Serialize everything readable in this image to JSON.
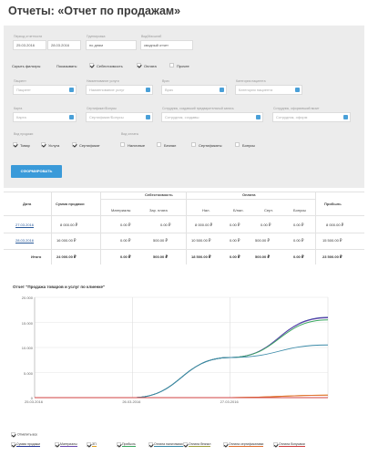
{
  "page": {
    "title": "Отчеты: «Отчет по продажам»"
  },
  "filters": {
    "period_label": "Период отчетности",
    "date_from": "25.03.2016",
    "date_to": "28.03.2016",
    "group_label": "Группировка",
    "group_value": "по дням",
    "mode_label": "Вид/Масштаб",
    "mode_value": "сводный отчет",
    "hide_filters": "Скрыть фильтры",
    "show_label": "Показывать:",
    "show_items": [
      "Себестоимость",
      "Оплата",
      "Прочее"
    ],
    "patient_label": "Пациент",
    "patient_ph": "Пациент",
    "service_label": "Наименование услуги",
    "service_ph": "Наименование услуг",
    "doctor_label": "Врач",
    "doctor_ph": "Врач",
    "service_cat_label": "Категория пациента",
    "service_cat_ph": "Категория пациента",
    "card_label": "Карта",
    "card_ph": "Карта",
    "coupon_label": "Сертификат/Бонусы",
    "coupon_ph": "Сертификат/Бонусы",
    "employee_label": "Сотрудник, создавший предварительный запись",
    "employee_ph": "Сотрудник, создавш",
    "employee2_label": "Сотрудник, оформивший визит",
    "employee2_ph": "Сотрудник, оформ",
    "sale_type_label": "Вид продажи",
    "sale_types": [
      "Товар",
      "Услуга",
      "Сертификат"
    ],
    "pay_type_label": "Вид оплаты",
    "pay_types": [
      "Наличные",
      "Безнал",
      "Сертификаты",
      "Бонусы"
    ],
    "submit": "СФОРМИРОВАТЬ"
  },
  "table": {
    "h_date": "Дата",
    "h_sum": "Сумма продажи",
    "h_cost": "Себестоимость",
    "h_pay": "Оплата",
    "h_profit": "Прибыль",
    "sub": [
      "Материалы",
      "Зар. плата",
      "Нал.",
      "Б/нал.",
      "Серт.",
      "Бонусы"
    ],
    "rows": [
      {
        "date": "27.03.2016",
        "sum": "8 000.00 ₽",
        "mat": "0.00 ₽",
        "zp": "0.00 ₽",
        "nal": "8 000.00 ₽",
        "bn": "0.00 ₽",
        "sert": "0.00 ₽",
        "bon": "0.00 ₽",
        "profit": "8 000.00 ₽"
      },
      {
        "date": "28.03.2016",
        "sum": "16 000.00 ₽",
        "mat": "0.00 ₽",
        "zp": "500.00 ₽",
        "nal": "10 500.00 ₽",
        "bn": "0.00 ₽",
        "sert": "500.00 ₽",
        "bon": "0.00 ₽",
        "profit": "15 500.00 ₽"
      }
    ],
    "total": {
      "label": "Итого",
      "sum": "24 000.00 ₽",
      "mat": "0.00 ₽",
      "zp": "500.00 ₽",
      "nal": "18 500.00 ₽",
      "bn": "0.00 ₽",
      "sert": "500.00 ₽",
      "bon": "0.00 ₽",
      "profit": "23 500.00 ₽"
    }
  },
  "chart_data": {
    "type": "line",
    "title": "Отчет \"Продажа товаров и услуг по клиенке\"",
    "x": [
      "25.03.2016",
      "26.03.2016",
      "27.03.2016",
      "28.03.2016"
    ],
    "x_ticks": [
      "25.03.2016",
      "26.03.2016",
      "27.03.2016"
    ],
    "y_ticks": [
      "0",
      "5.000",
      "10.000",
      "15.000",
      "20.000"
    ],
    "ylim": [
      0,
      20000
    ],
    "series": [
      {
        "name": "Сумма продажи",
        "color": "#2a3a9a",
        "values": [
          0,
          0,
          8000,
          16000
        ]
      },
      {
        "name": "Материалы",
        "color": "#6a4ab0",
        "values": [
          0,
          0,
          8000,
          15900
        ]
      },
      {
        "name": "ЗП",
        "color": "#e0a020",
        "values": [
          0,
          0,
          0,
          500
        ]
      },
      {
        "name": "Прибыль",
        "color": "#3aa860",
        "values": [
          0,
          0,
          8000,
          15500
        ]
      },
      {
        "name": "Оплата наличными",
        "color": "#3a8aa8",
        "values": [
          0,
          0,
          8000,
          10500
        ]
      },
      {
        "name": "Оплата безнал",
        "color": "#a0a040",
        "values": [
          0,
          0,
          0,
          0
        ]
      },
      {
        "name": "Оплата сертификатами",
        "color": "#e07030",
        "values": [
          0,
          0,
          0,
          500
        ]
      },
      {
        "name": "Оплата бонусами",
        "color": "#d04040",
        "values": [
          0,
          0,
          0,
          0
        ]
      }
    ],
    "legend_all": "Отметить все"
  }
}
